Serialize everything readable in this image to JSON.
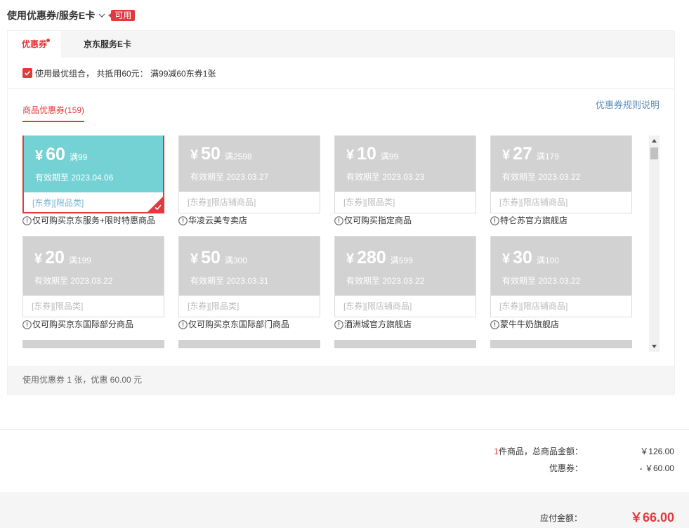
{
  "header": {
    "title": "使用优惠券/服务E卡",
    "badge": "可用"
  },
  "tabs": [
    {
      "label": "优惠券",
      "active": true
    },
    {
      "label": "京东服务E卡",
      "active": false
    }
  ],
  "best_combo": {
    "checked": true,
    "text": "使用最优组合， 共抵用60元： 满99减60东券1张"
  },
  "sub_tab": "商品优惠券(159)",
  "rules_link": "优惠券规则说明",
  "coupons": [
    {
      "symbol": "¥",
      "amount": "60",
      "condition": "满99",
      "expiry": "有效期至 2023.04.06",
      "tag": "[东券][限品类]",
      "note": "仅可购买京东服务+限时特惠商品",
      "selected": true
    },
    {
      "symbol": "¥",
      "amount": "50",
      "condition": "满2598",
      "expiry": "有效期至 2023.03.27",
      "tag": "[东券][限店铺商品]",
      "note": "华凌云美专卖店",
      "selected": false
    },
    {
      "symbol": "¥",
      "amount": "10",
      "condition": "满99",
      "expiry": "有效期至 2023.03.23",
      "tag": "[东券][限品类]",
      "note": "仅可购买指定商品",
      "selected": false
    },
    {
      "symbol": "¥",
      "amount": "27",
      "condition": "满179",
      "expiry": "有效期至 2023.03.22",
      "tag": "[东券][限店铺商品]",
      "note": "特仑苏官方旗舰店",
      "selected": false
    },
    {
      "symbol": "¥",
      "amount": "20",
      "condition": "满199",
      "expiry": "有效期至 2023.03.22",
      "tag": "[东券][限品类]",
      "note": "仅可购买京东国际部分商品",
      "selected": false
    },
    {
      "symbol": "¥",
      "amount": "50",
      "condition": "满300",
      "expiry": "有效期至 2023.03.31",
      "tag": "[东券][限品类]",
      "note": "仅可购买京东国际部门商品",
      "selected": false
    },
    {
      "symbol": "¥",
      "amount": "280",
      "condition": "满599",
      "expiry": "有效期至 2023.03.22",
      "tag": "[东券][限店铺商品]",
      "note": "酒洲城官方旗舰店",
      "selected": false
    },
    {
      "symbol": "¥",
      "amount": "30",
      "condition": "满100",
      "expiry": "有效期至 2023.03.22",
      "tag": "[东券][限店铺商品]",
      "note": "蒙牛牛奶旗舰店",
      "selected": false
    }
  ],
  "panel_footer": "使用优惠券 1 张，优惠 60.00 元",
  "summary": {
    "count": "1",
    "goods_label": "件商品，总商品金额：",
    "goods_value": "￥126.00",
    "coupon_label": "优惠券：",
    "coupon_value": "- ￥60.00",
    "pay_label": "应付金额：",
    "pay_value": "￥66.00"
  },
  "colors": {
    "accent": "#e4393c",
    "selected_coupon": "#74d2d4",
    "disabled_coupon": "#d2d2d2",
    "link": "#5c8ebd"
  }
}
